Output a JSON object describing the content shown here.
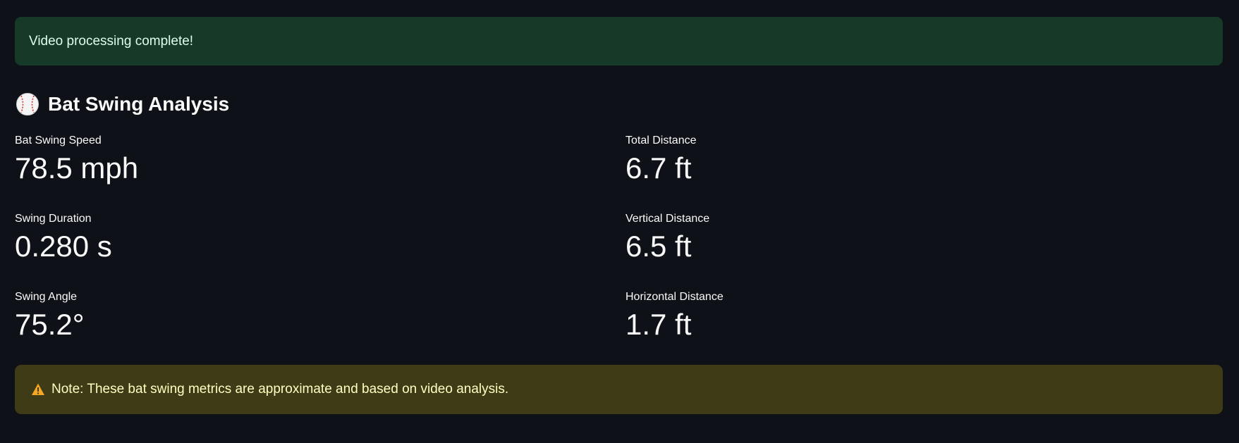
{
  "success_alert": {
    "message": "Video processing complete!"
  },
  "section": {
    "icon": "baseball-icon",
    "title": "Bat Swing Analysis"
  },
  "metrics": {
    "left": [
      {
        "label": "Bat Swing Speed",
        "value": "78.5 mph"
      },
      {
        "label": "Swing Duration",
        "value": "0.280 s"
      },
      {
        "label": "Swing Angle",
        "value": "75.2°"
      }
    ],
    "right": [
      {
        "label": "Total Distance",
        "value": "6.7 ft"
      },
      {
        "label": "Vertical Distance",
        "value": "6.5 ft"
      },
      {
        "label": "Horizontal Distance",
        "value": "1.7 ft"
      }
    ]
  },
  "warning_alert": {
    "icon": "warning-icon",
    "message": "Note: These bat swing metrics are approximate and based on video analysis."
  },
  "colors": {
    "background": "#0e1117",
    "success_bg": "#173928",
    "warning_bg": "#3e3b16",
    "warning_icon": "#f5a623"
  }
}
